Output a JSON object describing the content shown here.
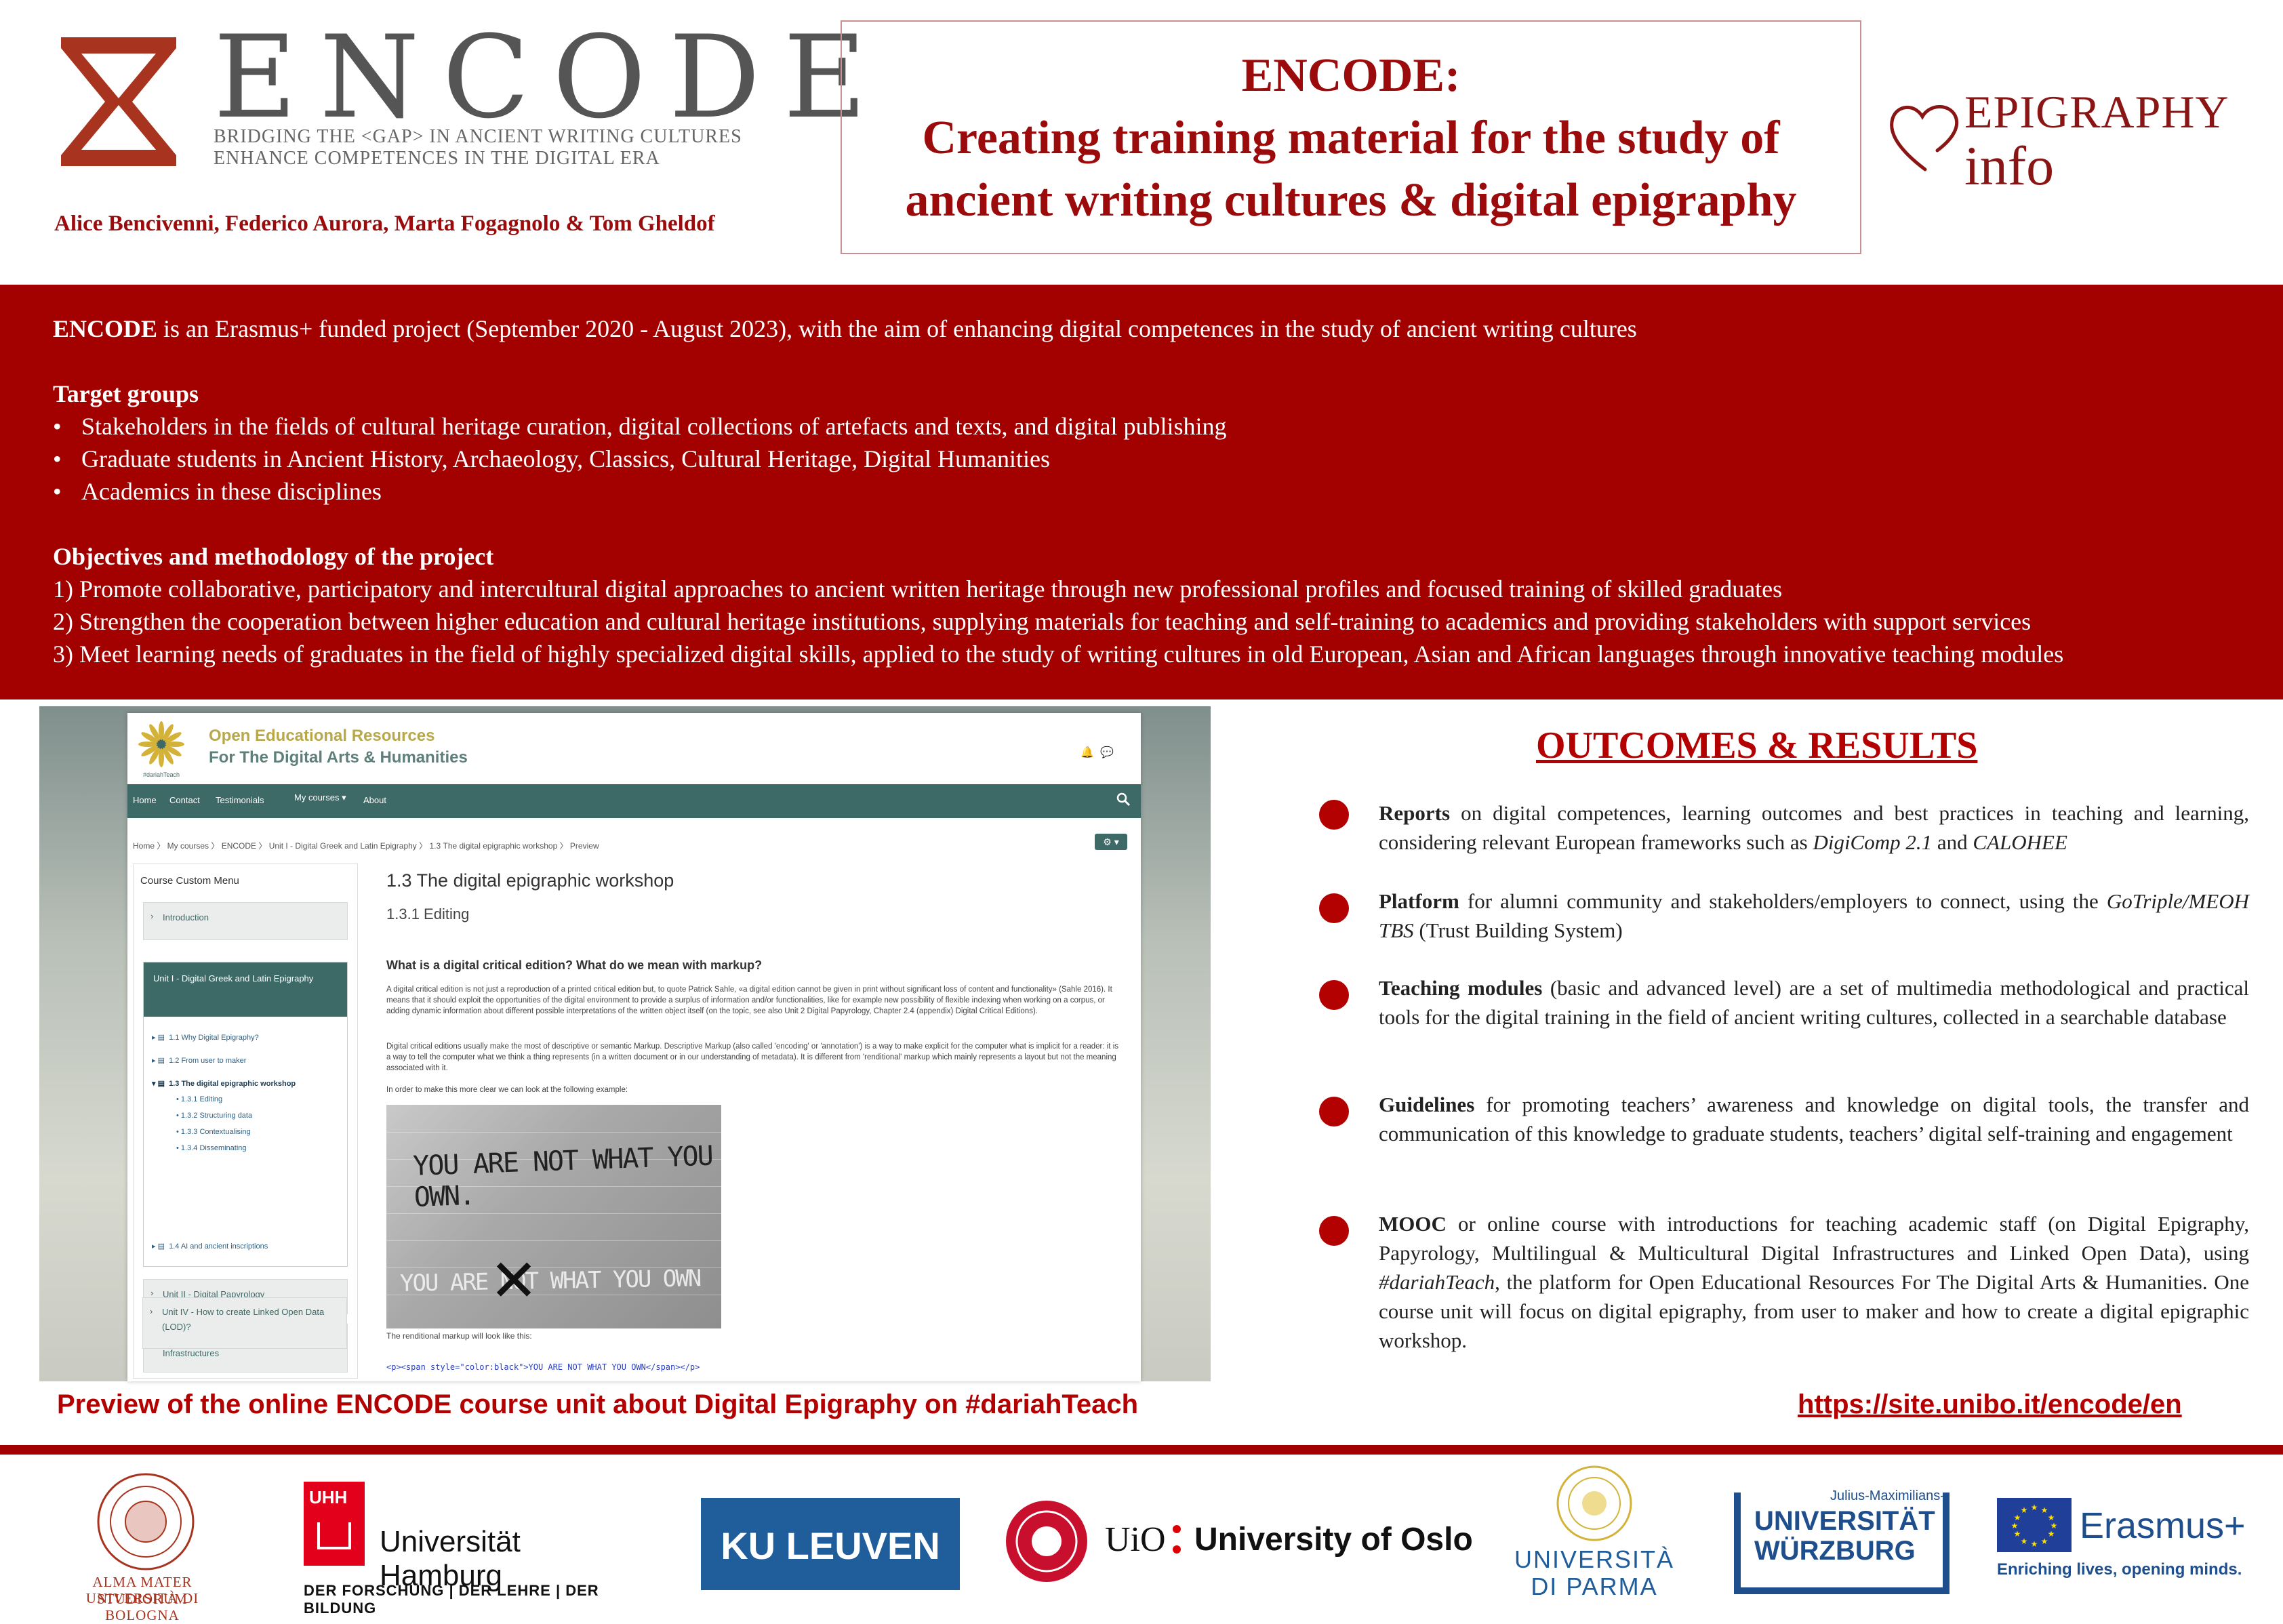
{
  "header": {
    "encode_word": "ENCODE",
    "encode_sub1": "BRIDGING THE <GAP> IN ANCIENT WRITING CULTURES",
    "encode_sub2": "ENHANCE COMPETENCES IN THE DIGITAL ERA",
    "authors": "Alice Bencivenni, Federico Aurora, Marta Fogagnolo & Tom Gheldof",
    "title_line1": "ENCODE:",
    "title_line2": "Creating training material for the study of",
    "title_line3": "ancient writing cultures & digital epigraphy",
    "epigraphy_logo_line1": "EPIGRAPHY",
    "epigraphy_logo_line2": "info"
  },
  "intro": {
    "lead_bold": "ENCODE",
    "lead_rest": " is an Erasmus+ funded project (September 2020 - August 2023), with the aim of enhancing digital competences in the study of ancient writing cultures",
    "target_heading": "Target groups",
    "target_items": [
      "Stakeholders in the fields of cultural heritage curation, digital collections of artefacts and texts, and digital publishing",
      "Graduate students in Ancient History, Archaeology, Classics, Cultural Heritage, Digital Humanities",
      "Academics in these disciplines"
    ],
    "objectives_heading": "Objectives and methodology of the project",
    "objectives": [
      "1) Promote collaborative, participatory and intercultural digital approaches to ancient written heritage through new professional profiles and focused training of skilled graduates",
      "2) Strengthen the cooperation between higher education and cultural heritage institutions, supplying materials for teaching and self-training to academics and providing stakeholders with support services",
      "3) Meet learning needs of graduates in the field of highly specialized digital skills, applied to the study of writing cultures in old European, Asian and African languages through innovative teaching modules"
    ]
  },
  "screenshot": {
    "site_title1": "Open Educational Resources",
    "site_title2": "For The Digital Arts & Humanities",
    "logo_caption": "#dariahTeach",
    "nav": [
      "Home",
      "Contact",
      "Testimonials",
      "My courses ▾",
      "About"
    ],
    "breadcrumb": "Home  〉 My courses  〉 ENCODE  〉 Unit I - Digital Greek and Latin Epigraphy  〉 1.3 The digital epigraphic workshop  〉 Preview",
    "menu_title": "Course Custom Menu",
    "menu_intro": "Introduction",
    "unit1": "Unit I - Digital Greek and Latin Epigraphy",
    "unit1_items": [
      "1.1 Why Digital Epigraphy?",
      "1.2 From user to maker",
      "1.3 The digital epigraphic workshop"
    ],
    "unit1_sub": [
      "1.3.1 Editing",
      "1.3.2 Structuring data",
      "1.3.3 Contextualising",
      "1.3.4 Disseminating"
    ],
    "unit1_last": "1.4 AI and ancient inscriptions",
    "unit2": "Unit II - Digital Papyrology",
    "unit3": "Unit III - Multilingual-Multicultural Digital Infrastructures",
    "unit4": "Unit IV - How to create Linked Open Data (LOD)?",
    "main_title": "1.3 The digital epigraphic workshop",
    "main_sub": "1.3.1 Editing",
    "question": "What is a digital critical edition? What do we mean with markup?",
    "para1": "A digital critical edition is not just a reproduction of a printed critical edition but, to quote Patrick Sahle, «a digital edition cannot be given in print without significant loss of content and functionality» (Sahle 2016). It means that it should exploit the opportunities of the digital environment to provide a surplus of information and/or functionalities, like for example new possibility of flexible indexing when working on a corpus, or adding dynamic information about different possible interpretations of the written object itself (on the topic, see also Unit 2 Digital Papyrology, Chapter 2.4 (appendix) Digital Critical Editions).",
    "para2": "Digital critical editions usually make the most of descriptive or semantic Markup. Descriptive Markup (also called 'encoding' or 'annotation') is a way to make explicit for the computer what is implicit for a reader: it is a way to tell the computer what we think a thing represents (in a written document or in our understanding of metadata). It is different from 'renditional' markup which mainly represents a layout but not the meaning associated with it.",
    "para3": "In order to make this more clear we can look at the following example:",
    "graffiti1": "YOU ARE NOT WHAT YOU OWN.",
    "graffiti2": "YOU ARE NOT WHAT YOU OWN",
    "rendition_label": "The renditional markup will look like this:",
    "code": "<p><span style=\"color:black\">YOU ARE NOT WHAT YOU OWN</span></p>"
  },
  "caption": "Preview of the online ENCODE course unit about Digital Epigraphy on #dariahTeach",
  "url": "https://site.unibo.it/encode/en",
  "outcomes": {
    "title": "OUTCOMES & RESULTS",
    "reports_bold": "Reports",
    "reports_text": " on digital competences, learning outcomes and best practices in teaching and learning, considering relevant European frameworks such as ",
    "reports_it1": "DigiComp 2.1",
    "reports_and": " and ",
    "reports_it2": "CALOHEE",
    "platform_bold": "Platform",
    "platform_text": " for alumni community and stakeholders/employers to connect, using the ",
    "platform_it": "GoTriple/MEOH TBS",
    "platform_tail": " (Trust Building System)",
    "teaching_bold": "Teaching modules",
    "teaching_text": " (basic and advanced level) are a set of multimedia methodological and practical tools for the digital training in the field of ancient writing cultures, collected in a searchable database",
    "guidelines_bold": "Guidelines",
    "guidelines_text": " for promoting teachers’ awareness and knowledge on digital tools, the transfer and communication of this knowledge to graduate students, teachers’ digital self-training and engagement",
    "mooc_bold": "MOOC",
    "mooc_text": " or online course with introductions for teaching academic staff (on Digital Epigraphy, Papyrology, Multilingual & Multicultural Digital Infrastructures and Linked Open Data), using ",
    "mooc_it": "#dariahTeach",
    "mooc_tail": ", the platform for Open Educational Resources For The Digital Arts & Humanities. One course unit will focus on digital epigraphy, from user to maker and how to create a digital epigraphic workshop."
  },
  "footer": {
    "bologna1": "ALMA MATER STUDIORUM",
    "bologna2": "UNIVERSITÀ DI BOLOGNA",
    "hamburg_mark": "UHH",
    "hamburg_name": "Universität Hamburg",
    "hamburg_motto": "DER FORSCHUNG | DER LEHRE | DER BILDUNG",
    "leuven": "KU LEUVEN",
    "oslo_uio": "UiO",
    "oslo_name": "University of Oslo",
    "parma1": "UNIVERSITÀ",
    "parma2": "DI PARMA",
    "wurzburg_top": "Julius-Maximilians-",
    "wurzburg1": "UNIVERSITÄT",
    "wurzburg2": "WÜRZBURG",
    "erasmus_name": "Erasmus+",
    "erasmus_tag": "Enriching lives, opening minds."
  },
  "colors": {
    "brand_red": "#a30000",
    "teal": "#3d6966"
  }
}
